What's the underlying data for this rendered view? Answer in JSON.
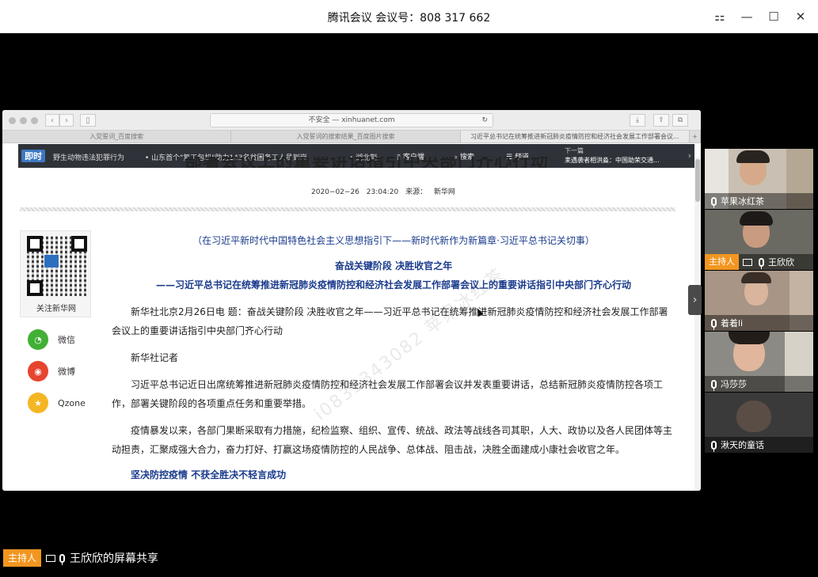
{
  "meeting": {
    "title": "腾讯会议 会议号：808 317 662",
    "window_buttons": [
      "⚏",
      "—",
      "☐",
      "✕"
    ]
  },
  "browser": {
    "url": "不安全 — xinhuanet.com",
    "tabs": [
      "入党誓词_百度搜索",
      "入党誓词的搜索结果_百度图片搜索",
      "习近平总书记在统筹推进新冠肺炎疫情防控和经济社会发展工作部署会议..."
    ],
    "site_nav": {
      "logo": "即时",
      "ticker": [
        "野生动物违法犯罪行为",
        "• 山东首个\"复工包机\"助力143名贫困务工人员到岗",
        "• 湖北荆州"
      ],
      "items": [
        "客户端",
        "搜索",
        "频道"
      ],
      "next_label": "下一篇",
      "next_title": "耒遇袭者相洪淼：中国助荣交通..."
    }
  },
  "article": {
    "headline_partial": "部署会议上的重要讲话指引中央部门齐心行动",
    "meta_date": "2020−02−26 23:04:20",
    "meta_source": "来源： 新华网",
    "qr_label": "关注新华网",
    "share": [
      {
        "label": "微信",
        "icon": "wechat-icon",
        "color": "#41b035"
      },
      {
        "label": "微博",
        "icon": "weibo-icon",
        "color": "#e6442e"
      },
      {
        "label": "Qzone",
        "icon": "qzone-icon",
        "color": "#f5b623"
      }
    ],
    "series": "（在习近平新时代中国特色社会主义思想指引下——新时代新作为新篇章·习近平总书记关切事）",
    "title1": "奋战关键阶段 决胜收官之年",
    "title2": "——习近平总书记在统筹推进新冠肺炎疫情防控和经济社会发展工作部署会议上的重要讲话指引中央部门齐心行动",
    "paragraphs": [
      "新华社北京2月26日电 题：奋战关键阶段 决胜收官之年——习近平总书记在统筹推进新冠肺炎疫情防控和经济社会发展工作部署会议上的重要讲话指引中央部门齐心行动",
      "新华社记者",
      "习近平总书记近日出席统筹推进新冠肺炎疫情防控和经济社会发展工作部署会议并发表重要讲话，总结新冠肺炎疫情防控各项工作，部署关键阶段的各项重点任务和重要举措。",
      "疫情暴发以来，各部门果断采取有力措施，纪检监察、组织、宣传、统战、政法等战线各司其职，人大、政协以及各人民团体等主动担责，汇聚成强大合力，奋力打好、打赢这场疫情防控的人民战争、总体战、阻击战，决胜全面建成小康社会收官之年。"
    ],
    "subhead": "坚决防控疫情 不获全胜决不轻言成功",
    "watermark": "i0833343082 苹果冰红茶"
  },
  "participants": [
    {
      "name": "苹果冰红茶",
      "host": false,
      "screen": false,
      "bg": "#c9bfb3",
      "face": "#d6a98a"
    },
    {
      "name": "王欣欣",
      "host": true,
      "host_label": "主持人",
      "screen": true,
      "bg": "#6b6a62",
      "face": "#c99b80"
    },
    {
      "name": "着着li",
      "host": false,
      "screen": false,
      "bg": "#a89586",
      "face": "#d8b59c"
    },
    {
      "name": "冯莎莎",
      "host": false,
      "screen": false,
      "bg": "#8c8a84",
      "face": "#e0b69c"
    },
    {
      "name": "湫天的童话",
      "host": false,
      "screen": false,
      "bg": "#3a3a3a",
      "face": "#5a4d46"
    }
  ],
  "bottom": {
    "host_label": "主持人",
    "text": "王欣欣的屏幕共享"
  }
}
